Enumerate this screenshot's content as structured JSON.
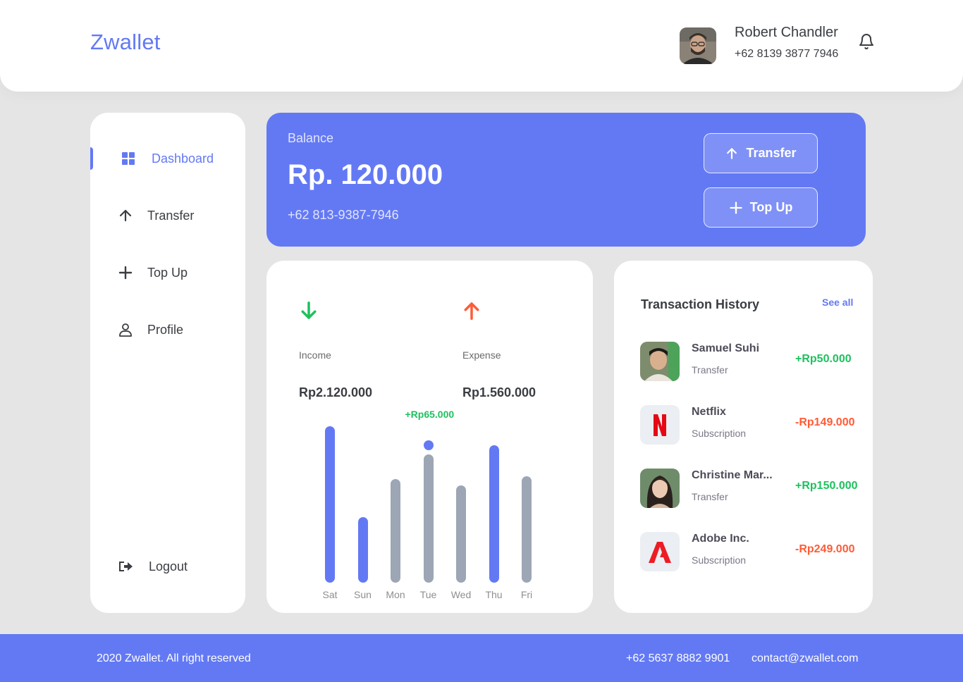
{
  "header": {
    "logo": "Zwallet",
    "user_name": "Robert Chandler",
    "user_phone": "+62 8139 3877 7946"
  },
  "sidebar": {
    "items": [
      {
        "label": "Dashboard",
        "icon": "grid-icon"
      },
      {
        "label": "Transfer",
        "icon": "arrow-up-icon"
      },
      {
        "label": "Top Up",
        "icon": "plus-icon"
      },
      {
        "label": "Profile",
        "icon": "user-icon"
      }
    ],
    "logout_label": "Logout",
    "active": "Dashboard"
  },
  "balance": {
    "label": "Balance",
    "amount": "Rp. 120.000",
    "phone": "+62 813-9387-7946",
    "transfer_label": "Transfer",
    "topup_label": "Top Up"
  },
  "stats": {
    "income_label": "Income",
    "income_value": "Rp2.120.000",
    "expense_label": "Expense",
    "expense_value": "Rp1.560.000",
    "income_color": "#1ec15f",
    "expense_color": "#ff5b37"
  },
  "chart_data": {
    "type": "bar",
    "categories": [
      "Sat",
      "Sun",
      "Mon",
      "Tue",
      "Wed",
      "Thu",
      "Fri"
    ],
    "values": [
      100,
      42,
      66,
      82,
      62,
      88,
      68
    ],
    "colors": [
      "#6379f4",
      "#6379f4",
      "#9da6b5",
      "#9da6b5",
      "#9da6b5",
      "#6379f4",
      "#9da6b5"
    ],
    "highlight": {
      "category": "Tue",
      "label": "+Rp65.000"
    }
  },
  "history": {
    "title": "Transaction History",
    "see_all": "See all",
    "items": [
      {
        "name": "Samuel Suhi",
        "type": "Transfer",
        "amount": "+Rp50.000",
        "positive": true,
        "thumb": "person-avatar-1"
      },
      {
        "name": "Netflix",
        "type": "Subscription",
        "amount": "-Rp149.000",
        "positive": false,
        "thumb": "netflix-logo"
      },
      {
        "name": "Christine Mar...",
        "type": "Transfer",
        "amount": "+Rp150.000",
        "positive": true,
        "thumb": "person-avatar-2"
      },
      {
        "name": "Adobe Inc.",
        "type": "Subscription",
        "amount": "-Rp249.000",
        "positive": false,
        "thumb": "adobe-logo"
      }
    ]
  },
  "footer": {
    "copyright": "2020 Zwallet. All right reserved",
    "phone": "+62 5637 8882 9901",
    "email": "contact@zwallet.com"
  },
  "colors": {
    "primary": "#6379f4",
    "positive": "#1ec15f",
    "negative": "#ff5b37"
  }
}
